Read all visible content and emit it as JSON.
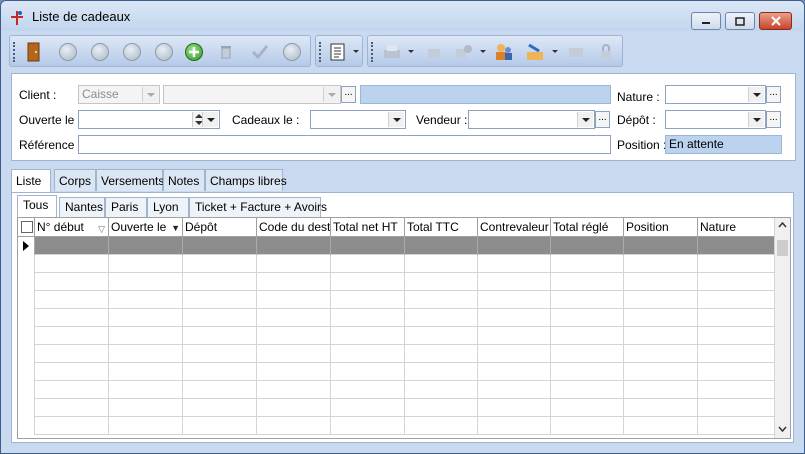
{
  "window": {
    "title": "Liste de cadeaux",
    "controls": {
      "minimize": "minimize-icon",
      "maximize": "maximize-icon",
      "close": "close-icon"
    }
  },
  "form": {
    "client_label": "Client :",
    "client_type_value": "Caisse",
    "client_code_value": "",
    "client_name_value": "",
    "nature_label": "Nature :",
    "nature_value": "",
    "ouverte_label": "Ouverte le :",
    "ouverte_value": "",
    "cadeaux_label": "Cadeaux le :",
    "cadeaux_value": "",
    "vendeur_label": "Vendeur :",
    "vendeur_value": "",
    "depot_label": "Dépôt :",
    "depot_value": "",
    "reference_label": "Référence :",
    "reference_value": "",
    "position_label": "Position :",
    "position_value": "En attente",
    "ellipsis": "..."
  },
  "tabs": [
    "Liste",
    "Corps",
    "Versements",
    "Notes",
    "Champs libres"
  ],
  "subtabs": [
    "Tous",
    "Nantes",
    "Paris",
    "Lyon",
    "Ticket + Facture + Avoirs"
  ],
  "grid": {
    "columns": [
      "N° début",
      "Ouverte le",
      "Dépôt",
      "Code du destir",
      "Total net HT",
      "Total TTC",
      "Contrevaleur T",
      "Total réglé",
      "Position",
      "Nature"
    ]
  },
  "colors": {
    "accent_field": "#bcd3f0",
    "selected_row": "#8c8c8c",
    "close_button": "#c6432c"
  }
}
